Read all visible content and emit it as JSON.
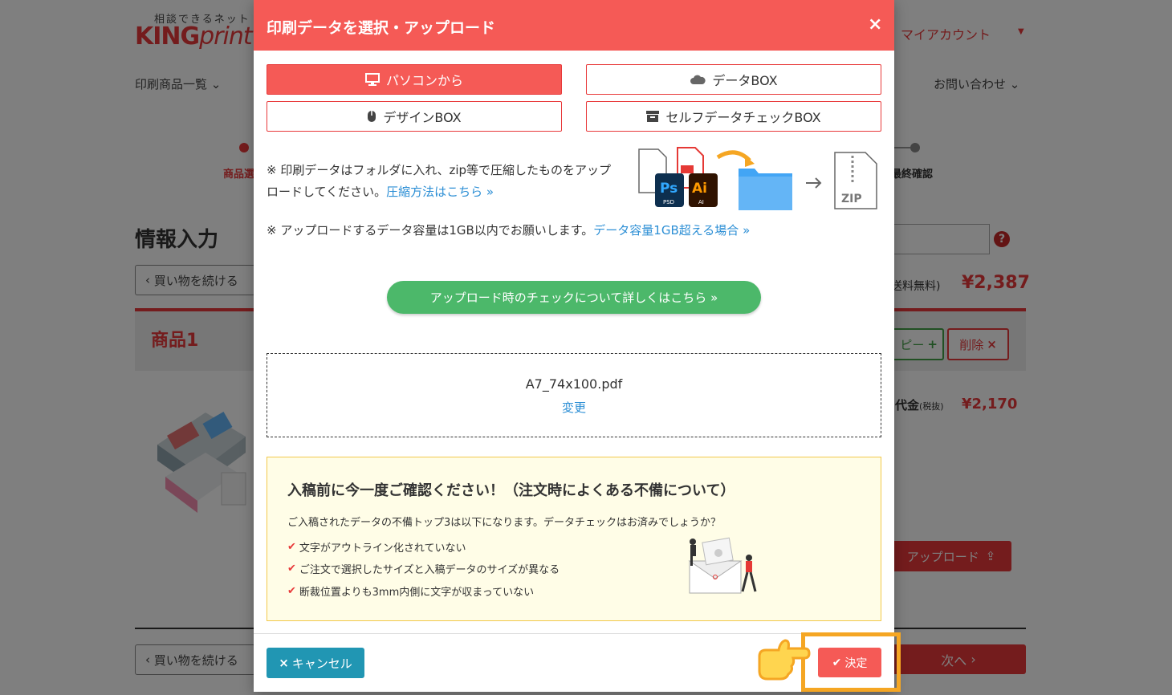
{
  "header": {
    "logo_tagline": "相談できるネット",
    "logo_king": "KING",
    "logo_print": "print",
    "account": "マイアカウント",
    "nav_products": "印刷商品一覧 ⌄",
    "nav_contact": "お問い合わせ ⌄"
  },
  "steps": {
    "left_label": "商品選",
    "right_label": "最終確認"
  },
  "page": {
    "title": "情報入力",
    "continue_shopping": "買い物を続ける",
    "shipping_free": "送料無料",
    "total_price": "¥2,387",
    "product_title": "商品1",
    "copy_label": "ピー",
    "delete_label": "削除",
    "price_label": "代金",
    "price_tax": "(税抜)",
    "price_value": "¥2,170",
    "upload_label": "アップロード",
    "next_label": "次へ"
  },
  "modal": {
    "title": "印刷データを選択・アップロード",
    "close_label": "×",
    "sources": {
      "pc": "パソコンから",
      "data_box": "データBOX",
      "design_box": "デザインBOX",
      "self_check_box": "セルフデータチェックBOX"
    },
    "note1_text": "※ 印刷データはフォルダに入れ、zip等で圧縮したものをアップロードしてください。",
    "note1_link": "圧縮方法はこちら »",
    "note2_text": "※ アップロードするデータ容量は1GB以内でお願いします。",
    "note2_link": "データ容量1GB超える場合 »",
    "illus_psd": "PSD",
    "illus_ai": "AI",
    "illus_zip": "ZIP",
    "check_button": "アップロード時のチェックについて詳しくはこちら »",
    "file_name": "A7_74x100.pdf",
    "change_link": "変更",
    "warning": {
      "title": "入稿前に今一度ご確認ください！（注文時によくある不備について）",
      "intro": "ご入稿されたデータの不備トップ3は以下になります。データチェックはお済みでしょうか？",
      "items": [
        "文字がアウトライン化されていない",
        "ご注文で選択したサイズと入稿データのサイズが異なる",
        "断裁位置よりも3mm内側に文字が収まっていない"
      ]
    },
    "cancel_label": "キャンセル",
    "confirm_label": "決定"
  },
  "colors": {
    "accent": "#f55a56",
    "green": "#4cb86a",
    "link": "#2d8fd5",
    "cancel": "#2196b3",
    "highlight": "#f5a623"
  }
}
